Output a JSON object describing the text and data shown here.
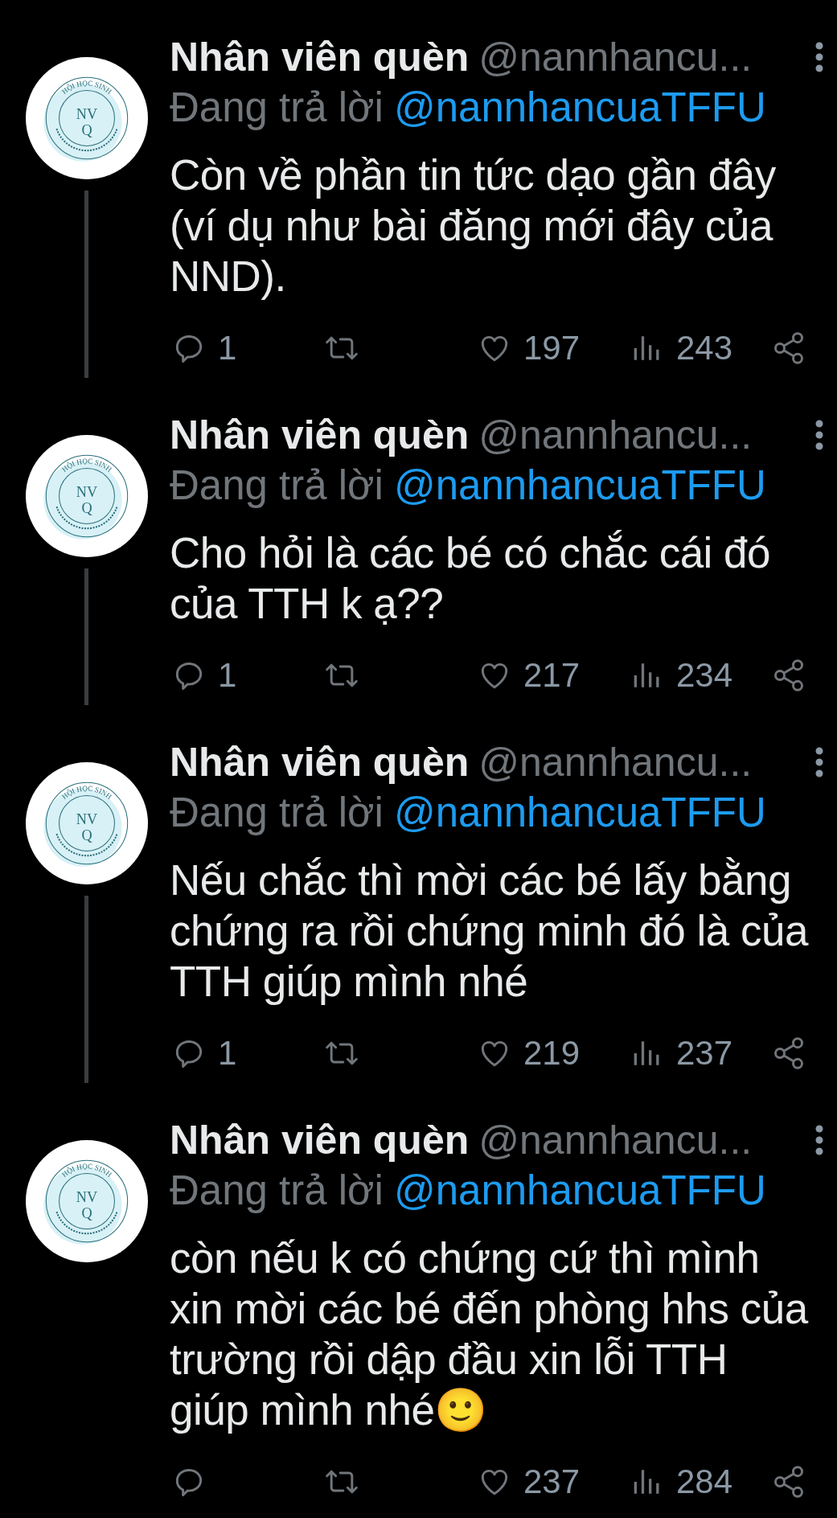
{
  "tweets": [
    {
      "avatar_logo": {
        "top_text": "HỘI HỌC SINH",
        "monogram_top": "NV",
        "monogram_bottom": "Q"
      },
      "name": "Nhân viên quèn",
      "handle": "@nannhancu...",
      "reply_prefix": "Đang trả lời",
      "reply_to": "@nannhancuaTFFU",
      "text": "Còn về phần tin tức dạo gần đây\n(ví dụ như bài đăng mới đây của\nNND).",
      "replies": "1",
      "likes": "197",
      "views": "243"
    },
    {
      "avatar_logo": {
        "top_text": "HỘI HỌC SINH",
        "monogram_top": "NV",
        "monogram_bottom": "Q"
      },
      "name": "Nhân viên quèn",
      "handle": "@nannhancu...",
      "reply_prefix": "Đang trả lời",
      "reply_to": "@nannhancuaTFFU",
      "text": "Cho hỏi là các bé có chắc cái đó\ncủa TTH k ạ??",
      "replies": "1",
      "likes": "217",
      "views": "234"
    },
    {
      "avatar_logo": {
        "top_text": "HỘI HỌC SINH",
        "monogram_top": "NV",
        "monogram_bottom": "Q"
      },
      "name": "Nhân viên quèn",
      "handle": "@nannhancu...",
      "reply_prefix": "Đang trả lời",
      "reply_to": "@nannhancuaTFFU",
      "text": "Nếu chắc thì mời các bé lấy bằng\nchứng ra rồi chứng minh đó là của\nTTH giúp mình nhé",
      "replies": "1",
      "likes": "219",
      "views": "237"
    },
    {
      "avatar_logo": {
        "top_text": "HỘI HỌC SINH",
        "monogram_top": "NV",
        "monogram_bottom": "Q"
      },
      "name": "Nhân viên quèn",
      "handle": "@nannhancu...",
      "reply_prefix": "Đang trả lời",
      "reply_to": "@nannhancuaTFFU",
      "text": "còn nếu k có chứng cứ thì mình\nxin mời các bé đến phòng hhs của\ntrường rồi dập đầu xin lỗi TTH\ngiúp mình nhé🙂",
      "likes": "237",
      "views": "284"
    }
  ]
}
